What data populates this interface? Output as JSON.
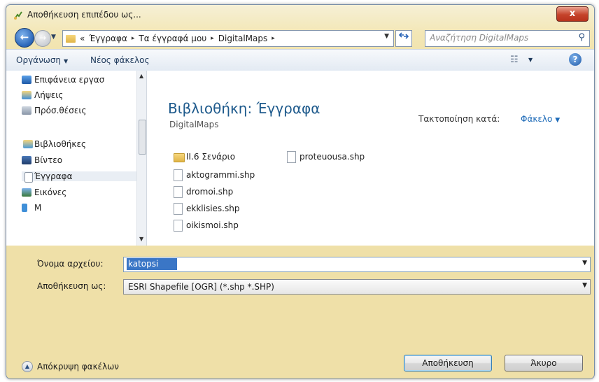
{
  "window": {
    "title": "Αποθήκευση επιπέδου ως...",
    "close_glyph": "x"
  },
  "nav": {
    "back_glyph": "←",
    "forward_glyph": "→"
  },
  "address": {
    "crumbs": [
      "«",
      "Έγγραφα",
      "Τα έγγραφά μου",
      "DigitalMaps"
    ],
    "separator": "▸"
  },
  "search": {
    "placeholder": "Αναζήτηση DigitalMaps"
  },
  "toolbar": {
    "organize_label": "Οργάνωση",
    "new_folder_label": "Νέος φάκελος",
    "help_glyph": "?"
  },
  "sidebar": {
    "items": [
      {
        "label": "Επιφάνεια εργασ",
        "icon": "desktop-icon"
      },
      {
        "label": "Λήψεις",
        "icon": "downloads-icon"
      },
      {
        "label": "Πρόσ.θέσεις",
        "icon": "recent-places-icon"
      },
      {
        "label": "Βιβλιοθήκες",
        "icon": "libraries-icon"
      },
      {
        "label": "Βίντεο",
        "icon": "video-icon"
      },
      {
        "label": "Έγγραφα",
        "icon": "documents-icon"
      },
      {
        "label": "Εικόνες",
        "icon": "pictures-icon"
      },
      {
        "label": "Μ",
        "icon": "music-icon"
      }
    ]
  },
  "content": {
    "library_title": "Βιβλιοθήκη: Έγγραφα",
    "library_subtitle": "DigitalMaps",
    "arrange_label": "Τακτοποίηση κατά:",
    "arrange_value": "Φάκελο",
    "files": [
      {
        "name": "II.6 Σενάριο",
        "type": "folder"
      },
      {
        "name": "aktogrammi.shp",
        "type": "file"
      },
      {
        "name": "dromoi.shp",
        "type": "file"
      },
      {
        "name": "ekklisies.shp",
        "type": "file"
      },
      {
        "name": "oikismoi.shp",
        "type": "file"
      },
      {
        "name": "proteuousa.shp",
        "type": "file"
      }
    ]
  },
  "form": {
    "filename_label": "Όνομα αρχείου:",
    "filename_value": "katopsi",
    "filetype_label": "Αποθήκευση ως:",
    "filetype_value": "ESRI Shapefile [OGR] (*.shp *.SHP)"
  },
  "footer": {
    "hide_folders_label": "Απόκρυψη φακέλων",
    "save_label": "Αποθήκευση",
    "cancel_label": "Άκυρο"
  }
}
